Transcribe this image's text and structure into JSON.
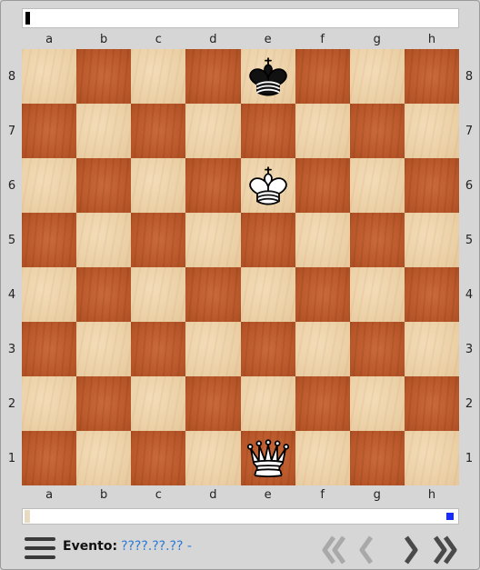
{
  "files": [
    "a",
    "b",
    "c",
    "d",
    "e",
    "f",
    "g",
    "h"
  ],
  "ranks": [
    "8",
    "7",
    "6",
    "5",
    "4",
    "3",
    "2",
    "1"
  ],
  "pieces": [
    {
      "square": "e8",
      "type": "king",
      "color": "black"
    },
    {
      "square": "e6",
      "type": "king",
      "color": "white"
    },
    {
      "square": "e1",
      "type": "queen",
      "color": "white"
    }
  ],
  "footer": {
    "event_label": "Evento:",
    "event_value": "????.??.?? -"
  },
  "colors": {
    "light_square": "#ecd1a8",
    "dark_square": "#bb5a2c",
    "link": "#2a7ad8",
    "nav_disabled": "#a9a9a9",
    "nav_enabled": "#4a4a4a"
  },
  "icons": {
    "menu": "hamburger-icon",
    "first": "double-chevron-left-icon",
    "prev": "chevron-left-icon",
    "next": "chevron-right-icon",
    "last": "double-chevron-right-icon"
  }
}
